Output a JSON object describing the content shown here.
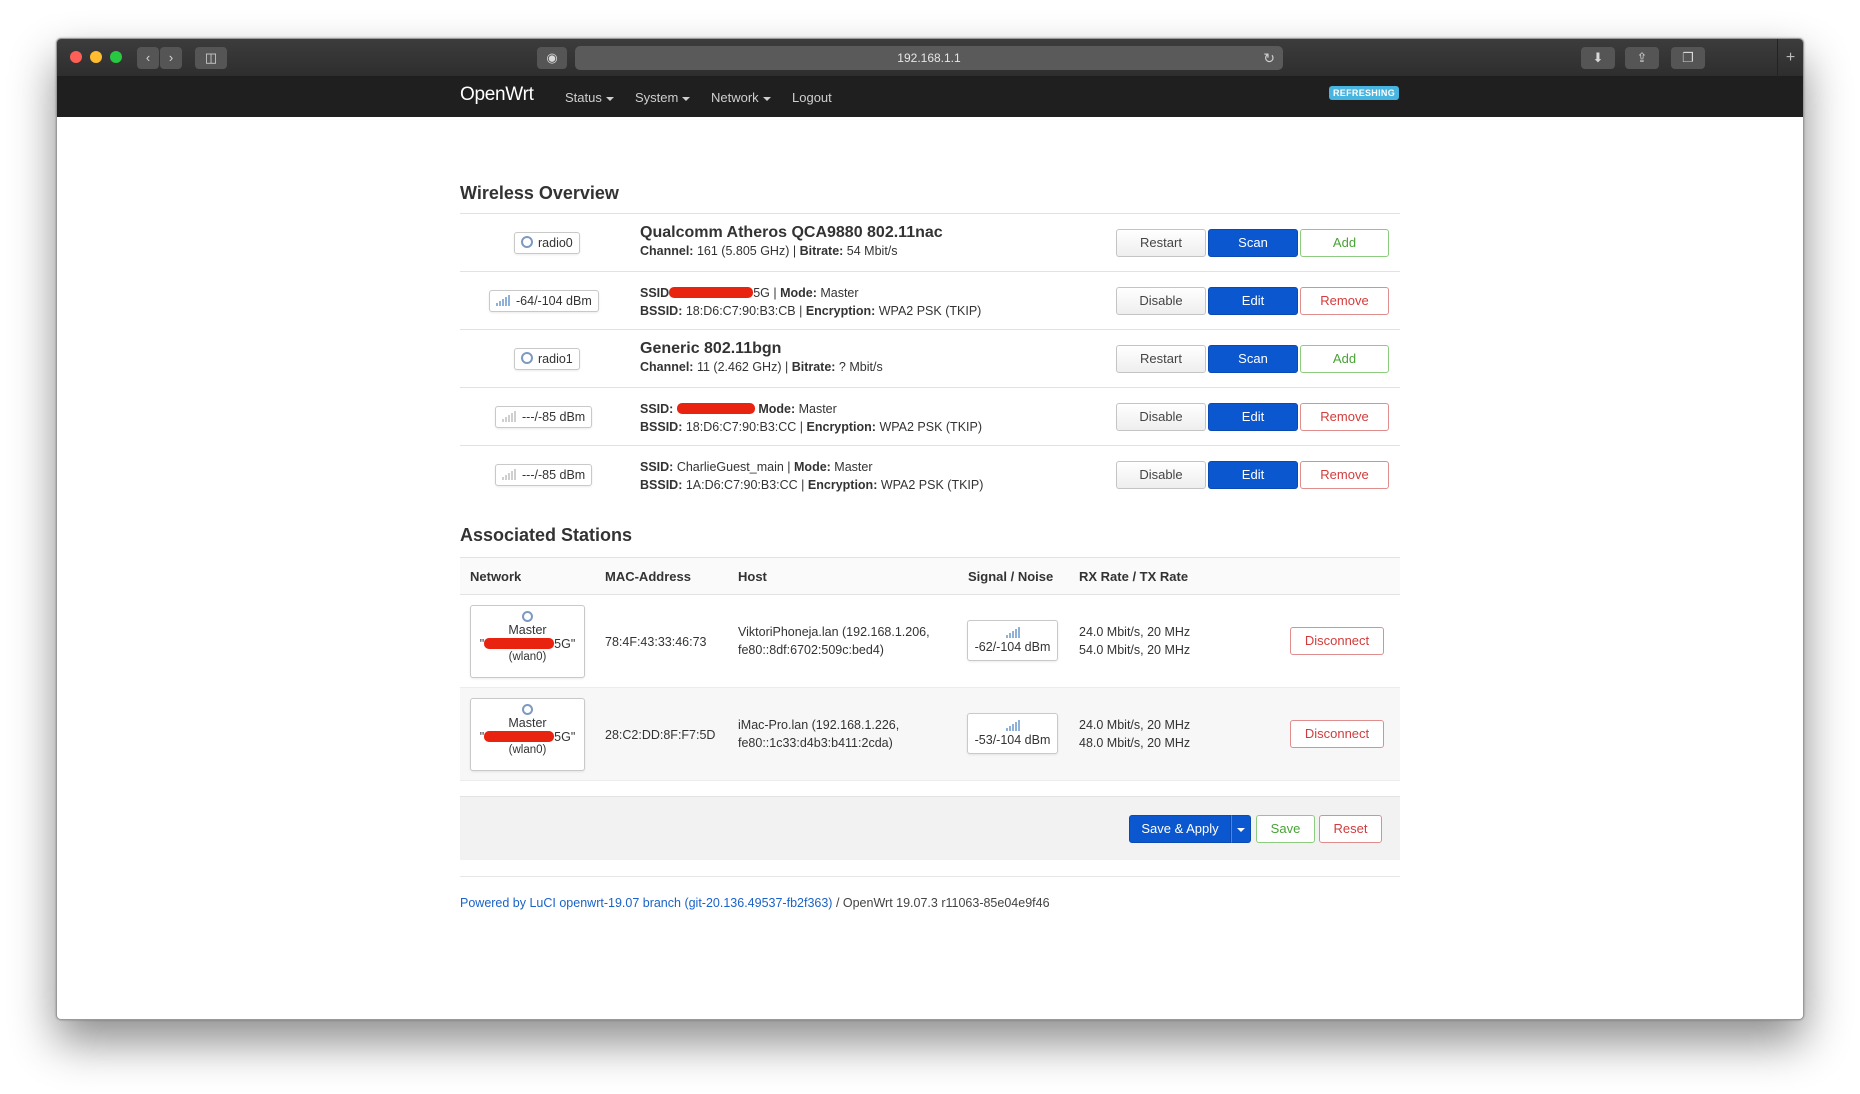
{
  "browser": {
    "url": "192.168.1.1"
  },
  "nav": {
    "brand": "OpenWrt",
    "menu": [
      "Status",
      "System",
      "Network",
      "Logout"
    ],
    "badge": "REFRESHING"
  },
  "wireless": {
    "heading": "Wireless Overview",
    "rows": [
      {
        "badge": "radio0",
        "badge_type": "radio",
        "title": "Qualcomm Atheros QCA9880 802.11nac",
        "line1_label": "Channel:",
        "line1_value": " 161 (5.805 GHz) | ",
        "line1_label2": "Bitrate:",
        "line1_value2": " 54 Mbit/s",
        "buttons": [
          "Restart",
          "Scan",
          "Add"
        ]
      },
      {
        "badge": "-64/-104 dBm",
        "badge_type": "signal",
        "ssid_label": "SSID",
        "ssid_suffix": "5G | ",
        "mode_label": "Mode:",
        "mode": " Master",
        "bssid_label": "BSSID:",
        "bssid": " 18:D6:C7:90:B3:CB | ",
        "enc_label": "Encryption:",
        "enc": " WPA2 PSK (TKIP)",
        "buttons": [
          "Disable",
          "Edit",
          "Remove"
        ]
      },
      {
        "badge": "radio1",
        "badge_type": "radio",
        "title": "Generic 802.11bgn",
        "line1_label": "Channel:",
        "line1_value": " 11 (2.462 GHz) | ",
        "line1_label2": "Bitrate:",
        "line1_value2": " ? Mbit/s",
        "buttons": [
          "Restart",
          "Scan",
          "Add"
        ]
      },
      {
        "badge": "---/-85 dBm",
        "badge_type": "nosignal",
        "ssid_label": "SSID:",
        "mode_label": "Mode:",
        "mode": " Master",
        "bssid_label": "BSSID:",
        "bssid": " 18:D6:C7:90:B3:CC | ",
        "enc_label": "Encryption:",
        "enc": " WPA2 PSK (TKIP)",
        "buttons": [
          "Disable",
          "Edit",
          "Remove"
        ]
      },
      {
        "badge": "---/-85 dBm",
        "badge_type": "nosignal",
        "ssid_label": "SSID:",
        "ssid_value": " CharlieGuest_main | ",
        "mode_label": "Mode:",
        "mode": " Master",
        "bssid_label": "BSSID:",
        "bssid": " 1A:D6:C7:90:B3:CC | ",
        "enc_label": "Encryption:",
        "enc": " WPA2 PSK (TKIP)",
        "buttons": [
          "Disable",
          "Edit",
          "Remove"
        ]
      }
    ]
  },
  "stations": {
    "heading": "Associated Stations",
    "columns": [
      "Network",
      "MAC-Address",
      "Host",
      "Signal / Noise",
      "RX Rate / TX Rate"
    ],
    "rows": [
      {
        "net_mode": "Master",
        "net_suffix": "5G\"",
        "net_iface": "(wlan0)",
        "mac": "78:4F:43:33:46:73",
        "host1": "ViktoriPhoneja.lan (192.168.1.206,",
        "host2": "fe80::8df:6702:509c:bed4)",
        "signal": "-62/-104 dBm",
        "rx": "24.0 Mbit/s, 20 MHz",
        "tx": "54.0 Mbit/s, 20 MHz",
        "action": "Disconnect"
      },
      {
        "net_mode": "Master",
        "net_suffix": "5G\"",
        "net_iface": "(wlan0)",
        "mac": "28:C2:DD:8F:F7:5D",
        "host1": "iMac-Pro.lan (192.168.1.226,",
        "host2": "fe80::1c33:d4b3:b411:2cda)",
        "signal": "-53/-104 dBm",
        "rx": "24.0 Mbit/s, 20 MHz",
        "tx": "48.0 Mbit/s, 20 MHz",
        "action": "Disconnect"
      }
    ]
  },
  "actions": {
    "save_apply": "Save & Apply",
    "save": "Save",
    "reset": "Reset"
  },
  "footer": {
    "link": "Powered by LuCI openwrt-19.07 branch (git-20.136.49537-fb2f363)",
    "rest": " / OpenWrt 19.07.3 r11063-85e04e9f46"
  },
  "colors": {
    "primary": "#0a57cf",
    "positive": "#47a335",
    "negative": "#d23c3c",
    "navbar": "#1f1f1f",
    "badge": "#48b4e0",
    "redaction": "#e8230f"
  }
}
